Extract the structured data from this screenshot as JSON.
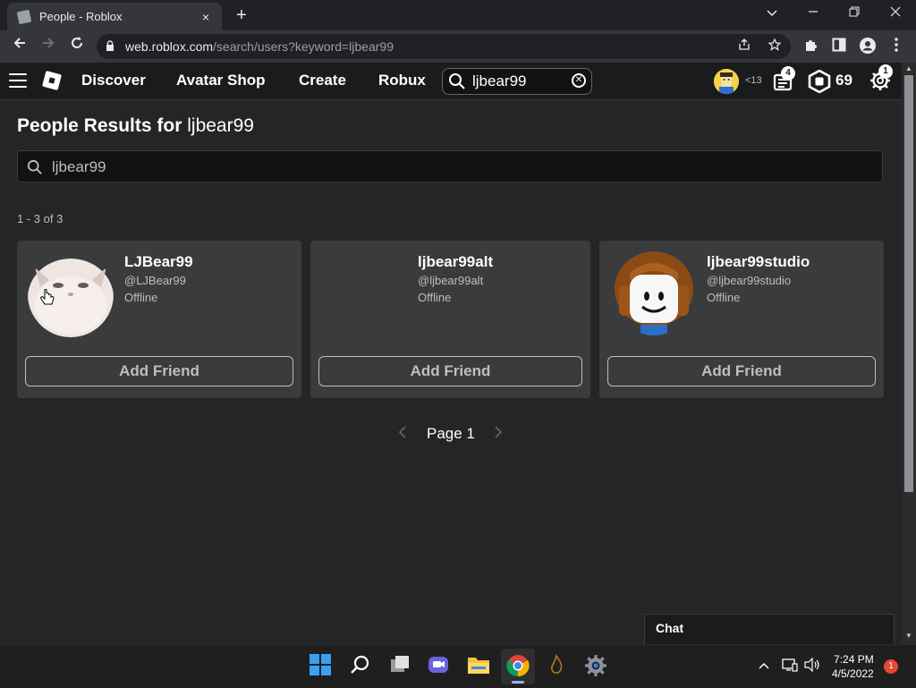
{
  "browser": {
    "tab_title": "People - Roblox",
    "url_host": "web.roblox.com",
    "url_path": "/search/users?keyword=ljbear99",
    "close_tab": "×",
    "new_tab": "+"
  },
  "header": {
    "nav": [
      "Discover",
      "Avatar Shop",
      "Create",
      "Robux"
    ],
    "search_value": "ljbear99",
    "age_label": "<13",
    "notifications_badge": "4",
    "robux_amount": "69",
    "settings_badge": "1"
  },
  "main": {
    "title_prefix": "People Results for",
    "title_keyword": "ljbear99",
    "search_value": "ljbear99",
    "result_count": "1 - 3 of 3",
    "results": [
      {
        "name": "LJBear99",
        "handle": "@LJBear99",
        "status": "Offline",
        "button": "Add Friend"
      },
      {
        "name": "ljbear99alt",
        "handle": "@ljbear99alt",
        "status": "Offline",
        "button": "Add Friend"
      },
      {
        "name": "ljbear99studio",
        "handle": "@ljbear99studio",
        "status": "Offline",
        "button": "Add Friend"
      }
    ],
    "pager_label": "Page 1",
    "chat_label": "Chat"
  },
  "taskbar": {
    "time": "7:24 PM",
    "date": "4/5/2022",
    "notification_count": "1"
  },
  "colors": {
    "page_bg": "#232527",
    "header_bg": "#191b1d",
    "card_bg": "#393b3d",
    "muted_text": "#bdbebe"
  }
}
